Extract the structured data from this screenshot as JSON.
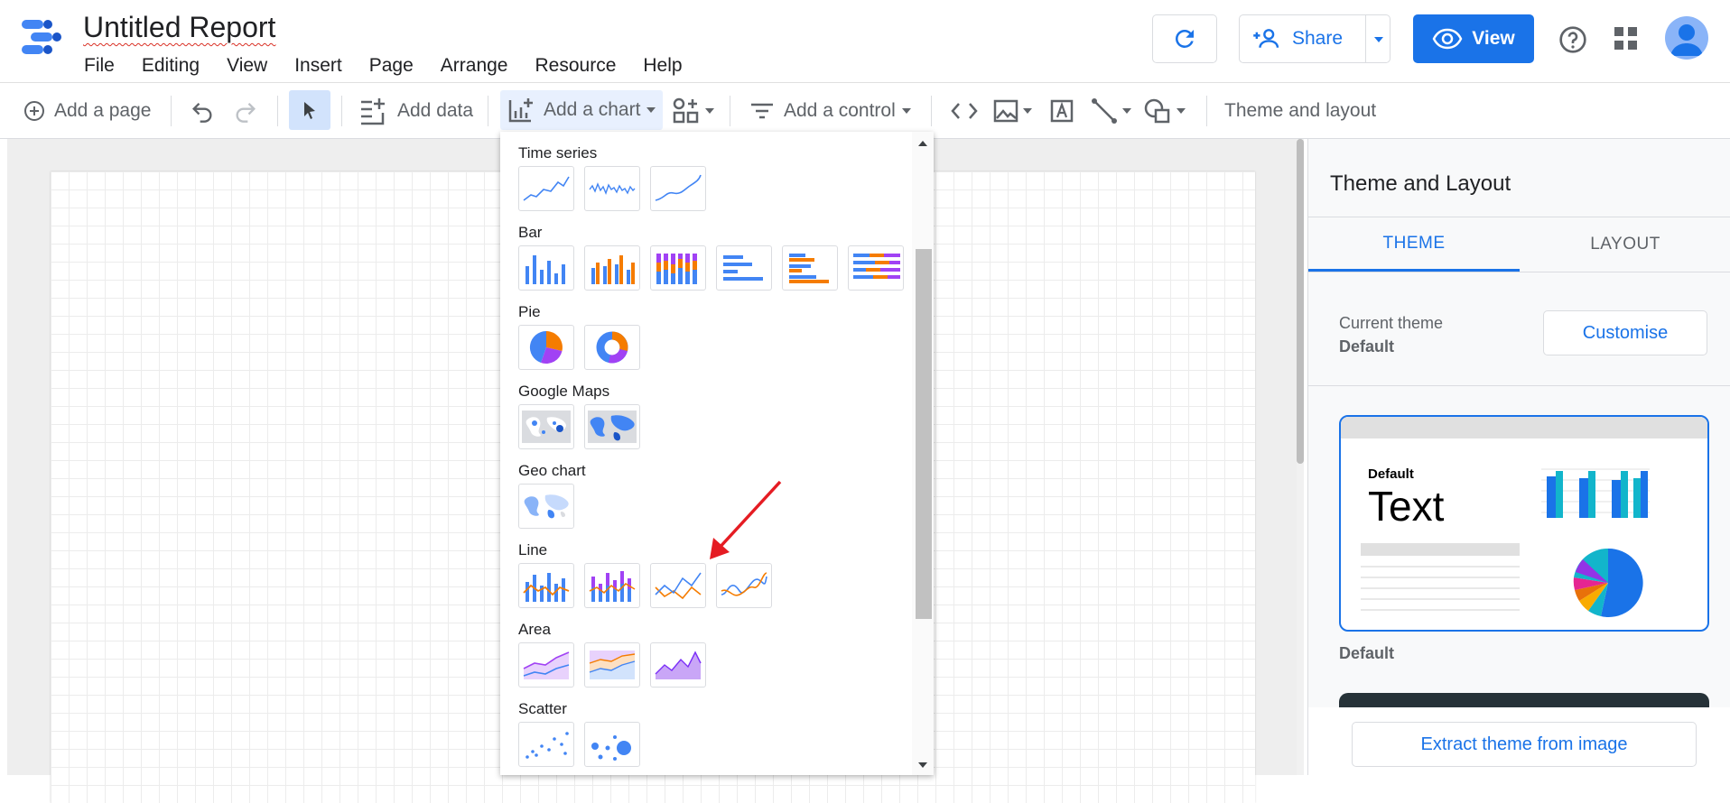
{
  "header": {
    "title": "Untitled Report",
    "menus": [
      "File",
      "Editing",
      "View",
      "Insert",
      "Page",
      "Arrange",
      "Resource",
      "Help"
    ],
    "share_label": "Share",
    "view_label": "View"
  },
  "toolbar": {
    "add_page": "Add a page",
    "add_data": "Add data",
    "add_chart": "Add a chart",
    "add_control": "Add a control",
    "theme_layout": "Theme and layout"
  },
  "chart_menu": {
    "categories": [
      "Time series",
      "Bar",
      "Pie",
      "Google Maps",
      "Geo chart",
      "Line",
      "Area",
      "Scatter"
    ]
  },
  "panel": {
    "title": "Theme and Layout",
    "tab_theme": "THEME",
    "tab_layout": "LAYOUT",
    "current_theme_label": "Current theme",
    "current_theme_value": "Default",
    "customise": "Customise",
    "card_small_text": "Default",
    "card_big_text": "Text",
    "card_label": "Default",
    "extract": "Extract theme from image"
  },
  "colors": {
    "accent": "#1a73e8",
    "series_orange": "#f57c00",
    "series_purple": "#a142f4",
    "annotation_red": "#e51c23"
  }
}
